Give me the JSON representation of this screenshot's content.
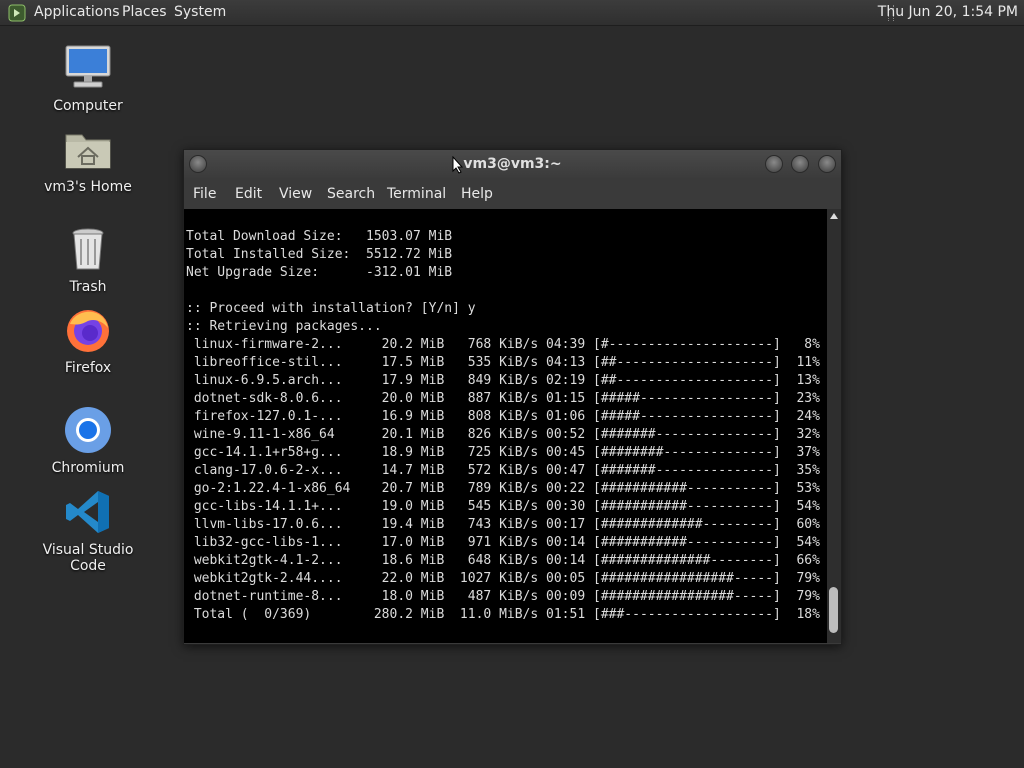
{
  "panel": {
    "menus": [
      "Applications",
      "Places",
      "System"
    ],
    "clock": "Thu Jun 20,  1:54 PM"
  },
  "desktop": {
    "icons": [
      {
        "label": "Computer",
        "icon": "computer-icon"
      },
      {
        "label": "vm3's Home",
        "icon": "home-folder-icon"
      },
      {
        "label": "Trash",
        "icon": "trash-icon"
      },
      {
        "label": "Firefox",
        "icon": "firefox-icon"
      },
      {
        "label": "Chromium",
        "icon": "chromium-icon"
      },
      {
        "label": "Visual Studio Code",
        "icon": "vscode-icon"
      }
    ]
  },
  "window": {
    "title": "vm3@vm3:~",
    "menu": [
      "File",
      "Edit",
      "View",
      "Search",
      "Terminal",
      "Help"
    ]
  },
  "terminal": {
    "lines": [
      "Total Download Size:   1503.07 MiB",
      "Total Installed Size:  5512.72 MiB",
      "Net Upgrade Size:      -312.01 MiB",
      "",
      ":: Proceed with installation? [Y/n] y",
      ":: Retrieving packages...",
      " linux-firmware-2...     20.2 MiB   768 KiB/s 04:39 [#---------------------]   8%",
      " libreoffice-stil...     17.5 MiB   535 KiB/s 04:13 [##--------------------]  11%",
      " linux-6.9.5.arch...     17.9 MiB   849 KiB/s 02:19 [##--------------------]  13%",
      " dotnet-sdk-8.0.6...     20.0 MiB   887 KiB/s 01:15 [#####-----------------]  23%",
      " firefox-127.0.1-...     16.9 MiB   808 KiB/s 01:06 [#####-----------------]  24%",
      " wine-9.11-1-x86_64      20.1 MiB   826 KiB/s 00:52 [#######---------------]  32%",
      " gcc-14.1.1+r58+g...     18.9 MiB   725 KiB/s 00:45 [########--------------]  37%",
      " clang-17.0.6-2-x...     14.7 MiB   572 KiB/s 00:47 [#######---------------]  35%",
      " go-2:1.22.4-1-x86_64    20.7 MiB   789 KiB/s 00:22 [###########-----------]  53%",
      " gcc-libs-14.1.1+...     19.0 MiB   545 KiB/s 00:30 [###########-----------]  54%",
      " llvm-libs-17.0.6...     19.4 MiB   743 KiB/s 00:17 [#############---------]  60%",
      " lib32-gcc-libs-1...     17.0 MiB   971 KiB/s 00:14 [###########-----------]  54%",
      " webkit2gtk-4.1-2...     18.6 MiB   648 KiB/s 00:14 [##############--------]  66%",
      " webkit2gtk-2.44....     22.0 MiB  1027 KiB/s 00:05 [#################-----]  79%",
      " dotnet-runtime-8...     18.0 MiB   487 KiB/s 00:09 [#################-----]  79%",
      " Total (  0/369)        280.2 MiB  11.0 MiB/s 01:51 [###-------------------]  18%"
    ]
  }
}
